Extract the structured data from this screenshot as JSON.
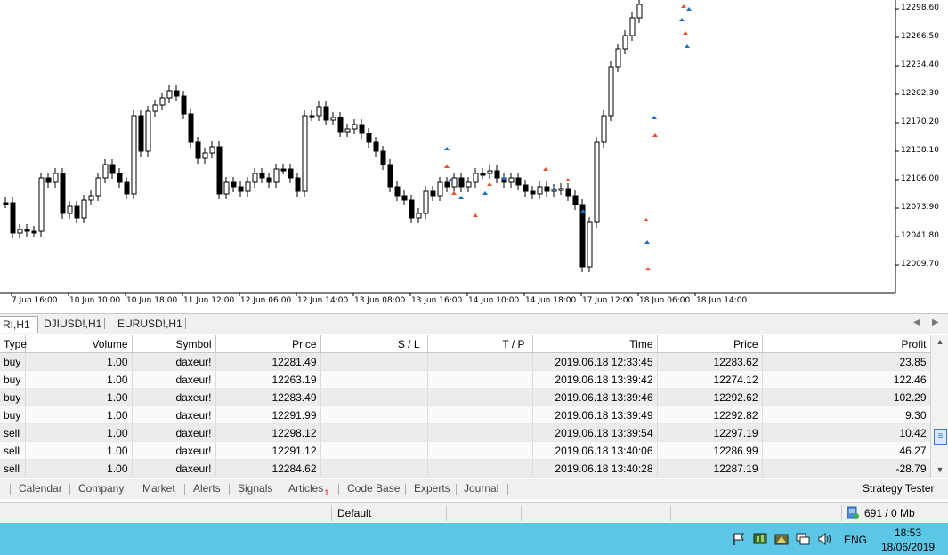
{
  "chart": {
    "price_labels": [
      "12298.60",
      "12266.50",
      "12234.40",
      "12202.30",
      "12170.20",
      "12138.10",
      "12106.00",
      "12073.90",
      "12041.80",
      "12009.70"
    ],
    "time_labels": [
      "7 Jun 16:00",
      "10 Jun 10:00",
      "10 Jun 18:00",
      "11 Jun 12:00",
      "12 Jun 06:00",
      "12 Jun 14:00",
      "13 Jun 08:00",
      "13 Jun 16:00",
      "14 Jun 10:00",
      "14 Jun 18:00",
      "17 Jun 12:00",
      "18 Jun 06:00",
      "18 Jun 14:00"
    ],
    "colors": {
      "bull": "#ffffff",
      "bear": "#000000",
      "buy_marker": "#1f6fbf",
      "sell_marker": "#e8502a"
    }
  },
  "chart_tabs": {
    "items": [
      "RI,H1",
      "DJIUSD!,H1",
      "EURUSD!,H1"
    ],
    "active_index": 0
  },
  "trades": {
    "headers": [
      "Type",
      "Volume",
      "Symbol",
      "Price",
      "S / L",
      "T / P",
      "Time",
      "Price",
      "Profit"
    ],
    "rows": [
      {
        "type": "buy",
        "volume": "1.00",
        "symbol": "daxeur!",
        "price": "12281.49",
        "sl": "",
        "tp": "",
        "time": "2019.06.18 12:33:45",
        "close_price": "12283.62",
        "profit": "23.85"
      },
      {
        "type": "buy",
        "volume": "1.00",
        "symbol": "daxeur!",
        "price": "12263.19",
        "sl": "",
        "tp": "",
        "time": "2019.06.18 13:39:42",
        "close_price": "12274.12",
        "profit": "122.46"
      },
      {
        "type": "buy",
        "volume": "1.00",
        "symbol": "daxeur!",
        "price": "12283.49",
        "sl": "",
        "tp": "",
        "time": "2019.06.18 13:39:46",
        "close_price": "12292.62",
        "profit": "102.29"
      },
      {
        "type": "buy",
        "volume": "1.00",
        "symbol": "daxeur!",
        "price": "12291.99",
        "sl": "",
        "tp": "",
        "time": "2019.06.18 13:39:49",
        "close_price": "12292.82",
        "profit": "9.30"
      },
      {
        "type": "sell",
        "volume": "1.00",
        "symbol": "daxeur!",
        "price": "12298.12",
        "sl": "",
        "tp": "",
        "time": "2019.06.18 13:39:54",
        "close_price": "12297.19",
        "profit": "10.42"
      },
      {
        "type": "sell",
        "volume": "1.00",
        "symbol": "daxeur!",
        "price": "12291.12",
        "sl": "",
        "tp": "",
        "time": "2019.06.18 13:40:06",
        "close_price": "12286.99",
        "profit": "46.27"
      },
      {
        "type": "sell",
        "volume": "1.00",
        "symbol": "daxeur!",
        "price": "12284.62",
        "sl": "",
        "tp": "",
        "time": "2019.06.18 13:40:28",
        "close_price": "12287.19",
        "profit": "-28.79"
      }
    ]
  },
  "toolbox": {
    "tabs": [
      "Calendar",
      "Company",
      "Market",
      "Alerts",
      "Signals",
      "Articles",
      "Code Base",
      "Experts",
      "Journal"
    ],
    "articles_badge": "1",
    "strategy_tester": "Strategy Tester"
  },
  "statusbar": {
    "profile": "Default",
    "memory": "691 / 0 Mb"
  },
  "taskbar": {
    "language": "ENG",
    "time": "18:53",
    "date": "18/06/2019",
    "icons": [
      "flag-icon",
      "monitor-icon",
      "network-icon",
      "display-icon",
      "volume-icon"
    ]
  }
}
